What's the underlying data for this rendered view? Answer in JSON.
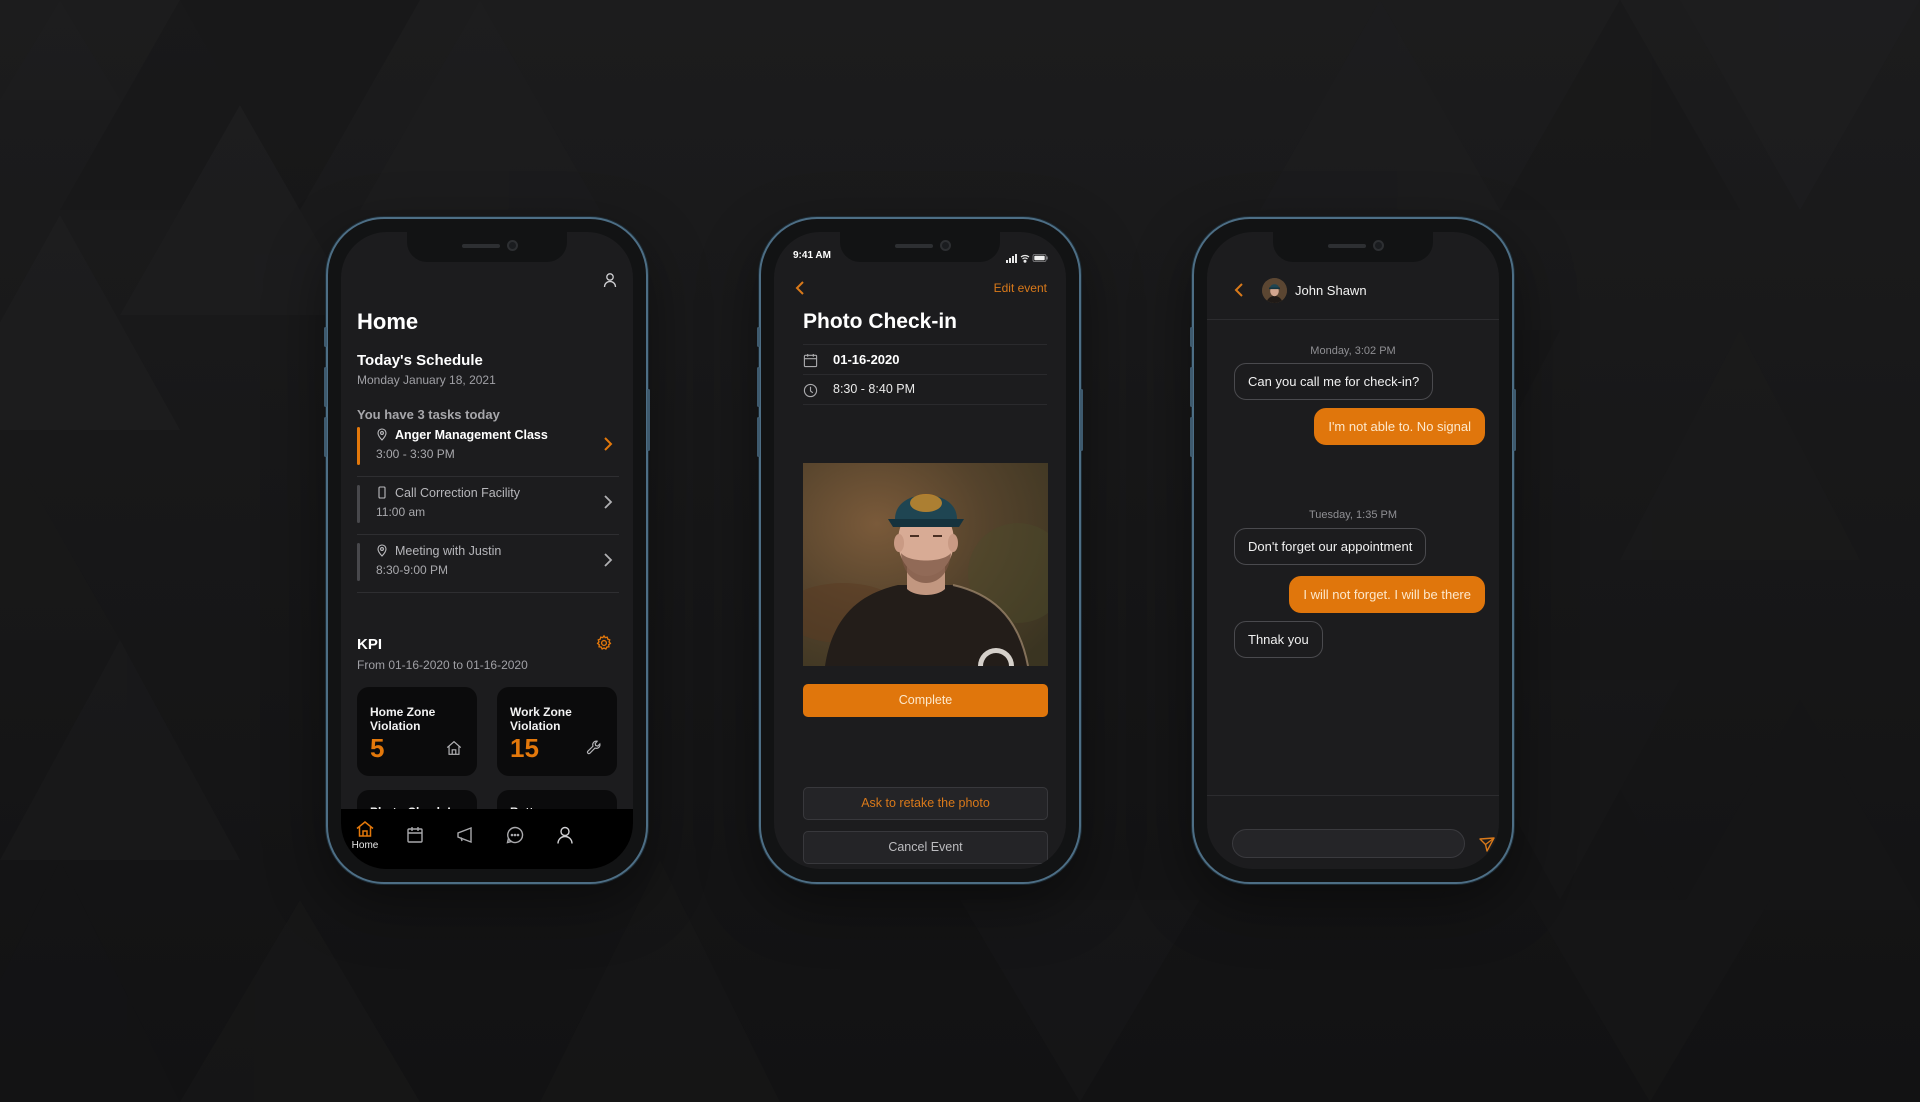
{
  "theme": {
    "accent": "#e0760c",
    "screen_bg": "#1c1c1e",
    "frame": "#4d6e85"
  },
  "home_screen": {
    "title": "Home",
    "profile_icon": "user-icon",
    "schedule_title": "Today's Schedule",
    "schedule_date": "Monday January 18, 2021",
    "tasks_summary": "You have 3 tasks today",
    "tasks": [
      {
        "name": "Anger Management Class",
        "time": "3:00 - 3:30 PM",
        "icon": "location-pin-icon",
        "active": true
      },
      {
        "name": "Call Correction Facility",
        "time": "11:00 am",
        "icon": "phone-device-icon",
        "active": false
      },
      {
        "name": "Meeting with Justin",
        "time": "8:30-9:00 PM",
        "icon": "location-pin-icon",
        "active": false
      }
    ],
    "kpi": {
      "title": "KPI",
      "range": "From 01-16-2020  to 01-16-2020",
      "settings_icon": "gear-icon",
      "cards": [
        {
          "label": "Home Zone Violation",
          "value": "5",
          "icon": "home-icon"
        },
        {
          "label": "Work Zone Violation",
          "value": "15",
          "icon": "wrench-icon"
        },
        {
          "label": "Photo Check-In",
          "value": "",
          "icon": ""
        },
        {
          "label": "Battery",
          "value": "",
          "icon": ""
        }
      ]
    },
    "tabbar": [
      {
        "label": "Home",
        "icon": "home-icon",
        "active": true
      },
      {
        "label": "",
        "icon": "calendar-icon",
        "active": false
      },
      {
        "label": "",
        "icon": "megaphone-icon",
        "active": false
      },
      {
        "label": "",
        "icon": "chat-bubble-icon",
        "active": false
      },
      {
        "label": "",
        "icon": "user-icon",
        "active": false
      }
    ]
  },
  "photo_checkin_screen": {
    "status_time": "9:41 AM",
    "back_icon": "chevron-left-icon",
    "edit_label": "Edit event",
    "title": "Photo Check-in",
    "date": "01-16-2020",
    "time_range": "8:30 - 8:40 PM",
    "photo_alt": "Check-in photo of man in cap and dark t-shirt",
    "complete_label": "Complete",
    "retake_label": "Ask to retake the photo",
    "cancel_label": "Cancel Event"
  },
  "chat_screen": {
    "contact_name": "John Shawn",
    "back_icon": "chevron-left-icon",
    "groups": [
      {
        "stamp": "Monday, 3:02 PM",
        "messages": [
          {
            "text": "Can you call me for check-in?",
            "direction": "in"
          },
          {
            "text": "I'm not able to. No signal",
            "direction": "out"
          }
        ]
      },
      {
        "stamp": "Tuesday, 1:35 PM",
        "messages": [
          {
            "text": "Don't forget our appointment",
            "direction": "in"
          },
          {
            "text": "I will not forget. I will be there",
            "direction": "out"
          },
          {
            "text": "Thnak you",
            "direction": "in"
          }
        ]
      }
    ],
    "input_value": "",
    "input_placeholder": "",
    "send_icon": "send-icon"
  }
}
